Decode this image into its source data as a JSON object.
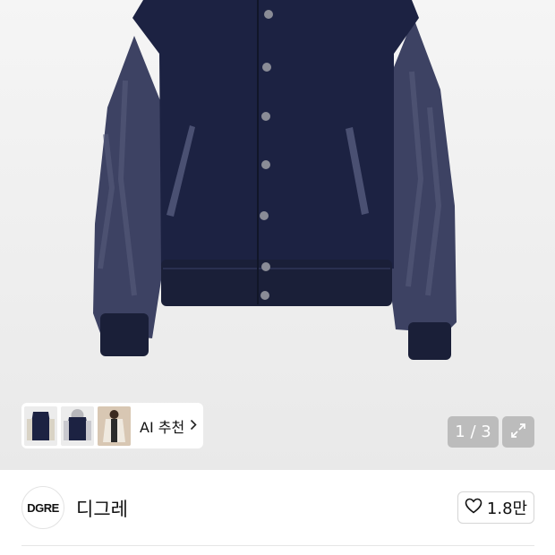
{
  "product_gallery": {
    "ai_recommend_label": "AI 추천",
    "pager_text": "1 / 3",
    "main_image_icon": "varsity-jacket-image",
    "expand_icon": "expand-icon"
  },
  "brand": {
    "logo_text": "DGRE",
    "name": "디그레",
    "like_count": "1.8만"
  },
  "colors": {
    "jacket_body": "#1b2140",
    "jacket_sleeve": "#3c4262",
    "hero_bg": "#efefef"
  }
}
